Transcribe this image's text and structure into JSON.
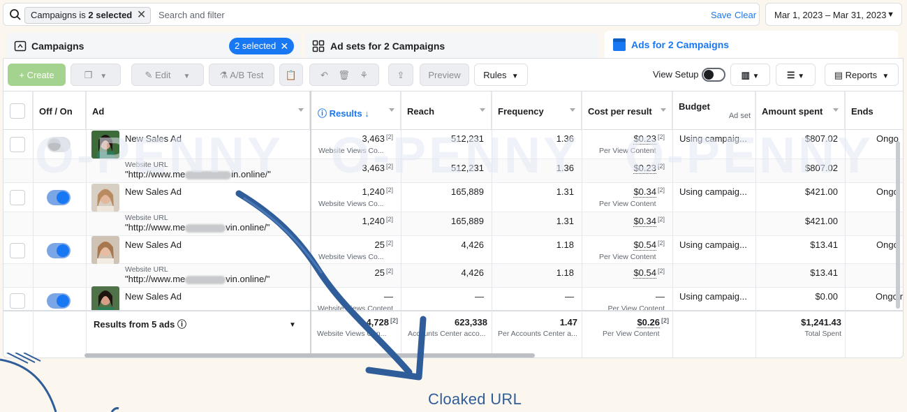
{
  "filter": {
    "chip_prefix": "Campaigns is ",
    "chip_bold": "2 selected",
    "placeholder": "Search and filter",
    "save": "Save",
    "clear": "Clear"
  },
  "date_range": "Mar 1, 2023 – Mar 31, 2023",
  "tabs": {
    "campaigns": "Campaigns",
    "selected_badge": "2 selected",
    "adsets": "Ad sets for 2 Campaigns",
    "ads": "Ads for 2 Campaigns"
  },
  "toolbar": {
    "create": "+ Create",
    "edit": "Edit",
    "ab_test": "A/B Test",
    "preview": "Preview",
    "rules": "Rules",
    "view_setup": "View Setup",
    "reports": "Reports"
  },
  "columns": {
    "off_on": "Off / On",
    "ad": "Ad",
    "results": "Results",
    "reach": "Reach",
    "frequency": "Frequency",
    "cost_per_result": "Cost per result",
    "budget": "Budget",
    "budget_sub": "Ad set",
    "amount_spent": "Amount spent",
    "ends": "Ends"
  },
  "rows": [
    {
      "name": "New Sales Ad",
      "on": false,
      "results": "3,463",
      "results_sub": "Website Views Co...",
      "reach": "512,231",
      "frequency": "1.36",
      "cpr": "$0.23",
      "cpr_sub": "Per View Content",
      "budget": "Using campaig...",
      "spent": "$807.02",
      "ends": "Ongo"
    },
    {
      "url_label": "Website URL",
      "url": "\"http://www.me",
      "url_end": "in.online/\"",
      "results": "3,463",
      "reach": "512,231",
      "frequency": "1.36",
      "cpr": "$0.23",
      "spent": "$807.02"
    },
    {
      "name": "New Sales Ad",
      "on": true,
      "results": "1,240",
      "results_sub": "Website Views Co...",
      "reach": "165,889",
      "frequency": "1.31",
      "cpr": "$0.34",
      "cpr_sub": "Per View Content",
      "budget": "Using campaig...",
      "spent": "$421.00",
      "ends": "Ongo"
    },
    {
      "url_label": "Website URL",
      "url": "\"http://www.me",
      "url_end": "vin.online/\"",
      "results": "1,240",
      "reach": "165,889",
      "frequency": "1.31",
      "cpr": "$0.34",
      "spent": "$421.00"
    },
    {
      "name": "New Sales Ad",
      "on": true,
      "results": "25",
      "results_sub": "Website Views Co...",
      "reach": "4,426",
      "frequency": "1.18",
      "cpr": "$0.54",
      "cpr_sub": "Per View Content",
      "budget": "Using campaig...",
      "spent": "$13.41",
      "ends": "Ongo"
    },
    {
      "url_label": "Website URL",
      "url": "\"http://www.me",
      "url_end": "vin.online/\"",
      "results": "25",
      "reach": "4,426",
      "frequency": "1.18",
      "cpr": "$0.54",
      "spent": "$13.41"
    },
    {
      "name": "New Sales Ad",
      "on": true,
      "results": "—",
      "results_sub": "Website Views Content",
      "reach": "—",
      "frequency": "—",
      "cpr": "—",
      "cpr_sub": "Per View Content",
      "budget": "Using campaig...",
      "spent": "$0.00",
      "ends": "Ongoin"
    }
  ],
  "totals": {
    "label": "Results from 5 ads",
    "results": "4,728",
    "results_sub": "Website Views Con...",
    "reach": "623,338",
    "reach_sub": "Accounts Center acco...",
    "frequency": "1.47",
    "frequency_sub": "Per Accounts Center a...",
    "cpr": "$0.26",
    "cpr_sub": "Per View Content",
    "spent": "$1,241.43",
    "spent_sub": "Total Spent"
  },
  "superscript": "[2]",
  "watermark": "O-PENNY",
  "annotation": "Cloaked URL",
  "colors": {
    "accent": "#1877f2",
    "create_green": "#a4d28f",
    "arrow": "#2f5d9a",
    "background": "#fbf6ee"
  }
}
